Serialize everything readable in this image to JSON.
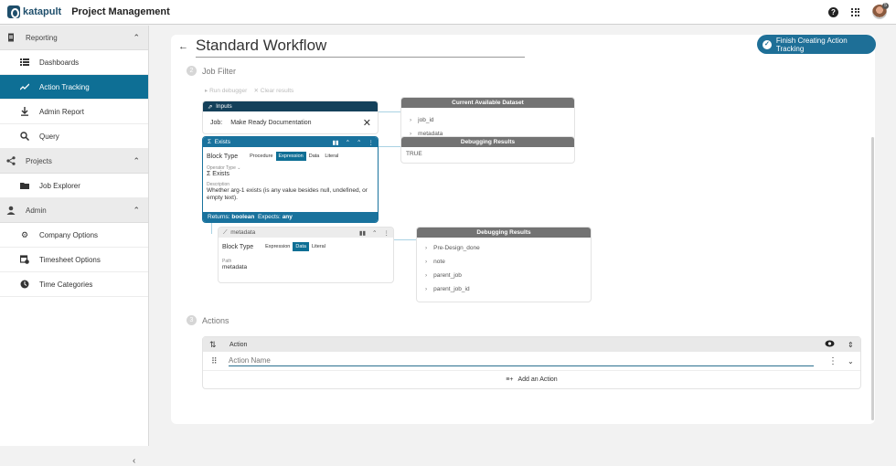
{
  "brand": {
    "logo_text": "katapult",
    "app_title": "Project Management",
    "avatar_badge": "5"
  },
  "topbar": {
    "help_icon": "help-circle-icon",
    "apps_icon": "apps-grid-icon"
  },
  "sidebar": {
    "sections": [
      {
        "label": "Reporting",
        "icon": "document-icon",
        "items": [
          {
            "label": "Dashboards",
            "icon": "list-icon",
            "active": false
          },
          {
            "label": "Action Tracking",
            "icon": "trending-icon",
            "active": true
          },
          {
            "label": "Admin Report",
            "icon": "download-icon",
            "active": false
          },
          {
            "label": "Query",
            "icon": "search-icon",
            "active": false
          }
        ]
      },
      {
        "label": "Projects",
        "icon": "share-icon",
        "items": [
          {
            "label": "Job Explorer",
            "icon": "folder-icon",
            "active": false
          }
        ]
      },
      {
        "label": "Admin",
        "icon": "person-icon",
        "items": [
          {
            "label": "Company Options",
            "icon": "gear-icon",
            "active": false
          },
          {
            "label": "Timesheet Options",
            "icon": "calendar-clock-icon",
            "active": false
          },
          {
            "label": "Time Categories",
            "icon": "clock-icon",
            "active": false
          }
        ]
      }
    ]
  },
  "header": {
    "title": "Standard Workflow",
    "finish_label": "Finish Creating Action Tracking"
  },
  "job_filter": {
    "number": "2",
    "label": "Job Filter",
    "run_debugger": "Run debugger",
    "clear_results": "Clear results",
    "inputs": {
      "title": "Inputs",
      "job_label": "Job:",
      "job_value": "Make Ready Documentation"
    },
    "available": {
      "title": "Current Available Dataset",
      "items": [
        "job_id",
        "metadata"
      ]
    },
    "debug1": {
      "title": "Debugging Results",
      "value": "TRUE"
    },
    "exists": {
      "title": "Exists",
      "block_type_label": "Block Type",
      "block_types": [
        "Procedure",
        "Expression",
        "Data",
        "Literal"
      ],
      "selected": "Expression",
      "operator_label": "Operator Type",
      "operator_value": "Exists",
      "description_label": "Description",
      "description": "Whether arg-1 exists (is any value besides null, undefined, or empty text).",
      "returns_label": "Returns:",
      "returns_value": "boolean",
      "expects_label": "Expects:",
      "expects_value": "any"
    },
    "metadata": {
      "title": "metadata",
      "block_type_label": "Block Type",
      "block_types": [
        "Expression",
        "Data",
        "Literal"
      ],
      "selected": "Data",
      "path_label": "Path",
      "path_value": "metadata"
    },
    "debug2": {
      "title": "Debugging Results",
      "items": [
        "Pre-Design_done",
        "note",
        "parent_job",
        "parent_job_id"
      ]
    }
  },
  "actions": {
    "number": "3",
    "label": "Actions",
    "column": "Action",
    "placeholder": "Action Name",
    "add_label": "Add an Action"
  }
}
